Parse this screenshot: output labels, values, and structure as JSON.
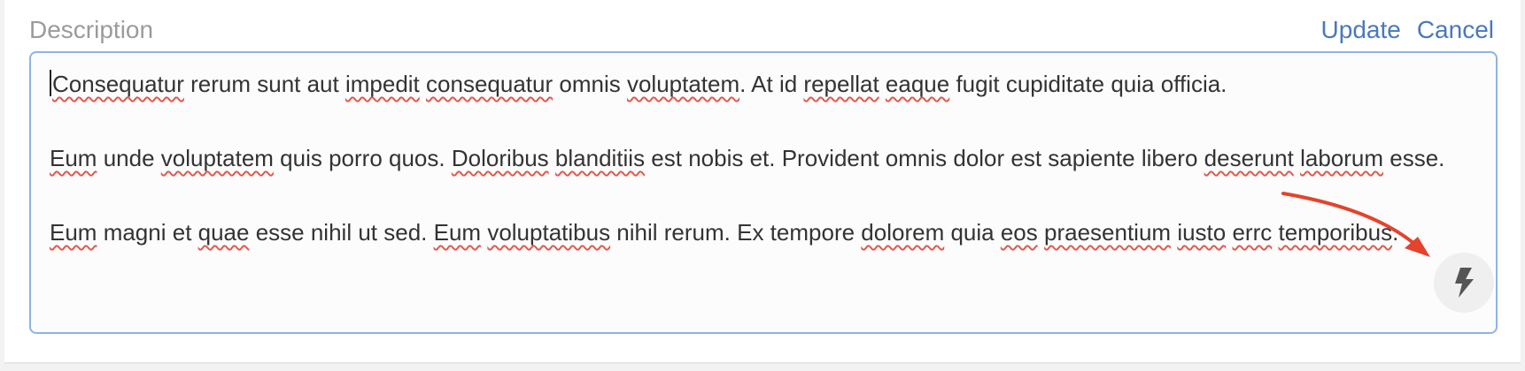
{
  "field": {
    "label": "Description",
    "update_label": "Update",
    "cancel_label": "Cancel"
  },
  "editor": {
    "paragraphs": [
      [
        {
          "t": "Consequatur",
          "s": true
        },
        {
          "t": " rerum sunt aut "
        },
        {
          "t": "impedit",
          "s": true
        },
        {
          "t": " "
        },
        {
          "t": "consequatur",
          "s": true
        },
        {
          "t": " omnis "
        },
        {
          "t": "voluptatem",
          "s": true
        },
        {
          "t": ". At id "
        },
        {
          "t": "repellat",
          "s": true
        },
        {
          "t": " "
        },
        {
          "t": "eaque",
          "s": true
        },
        {
          "t": " fugit cupiditate quia officia."
        }
      ],
      [
        {
          "t": "Eum",
          "s": true
        },
        {
          "t": " unde "
        },
        {
          "t": "voluptatem",
          "s": true
        },
        {
          "t": " quis porro quos. "
        },
        {
          "t": "Doloribus",
          "s": true
        },
        {
          "t": " "
        },
        {
          "t": "blanditiis",
          "s": true
        },
        {
          "t": " est nobis et. Provident omnis dolor est sapiente libero "
        },
        {
          "t": "deserunt",
          "s": true
        },
        {
          "t": " "
        },
        {
          "t": "laborum",
          "s": true
        },
        {
          "t": " esse."
        }
      ],
      [
        {
          "t": "Eum",
          "s": true
        },
        {
          "t": " magni et "
        },
        {
          "t": "quae",
          "s": true
        },
        {
          "t": " esse nihil ut sed. "
        },
        {
          "t": "Eum",
          "s": true
        },
        {
          "t": " "
        },
        {
          "t": "voluptatibus",
          "s": true
        },
        {
          "t": " nihil rerum. Ex tempore "
        },
        {
          "t": "dolorem",
          "s": true
        },
        {
          "t": " quia "
        },
        {
          "t": "eos",
          "s": true
        },
        {
          "t": " "
        },
        {
          "t": "praesentium",
          "s": true
        },
        {
          "t": " "
        },
        {
          "t": "iusto",
          "s": true
        },
        {
          "t": " "
        },
        {
          "t": "errc",
          "s": true
        },
        {
          "t": " "
        },
        {
          "t": "temporibus",
          "s": true
        },
        {
          "t": "."
        }
      ]
    ]
  },
  "grammar_button": {
    "icon": "lightning-bolt-icon"
  },
  "annotation": {
    "icon": "red-arrow-icon",
    "color": "#e4432d"
  },
  "colors": {
    "accent": "#4a78bd",
    "focus_border": "#8db3e6",
    "spell_error": "#e05a4f"
  }
}
